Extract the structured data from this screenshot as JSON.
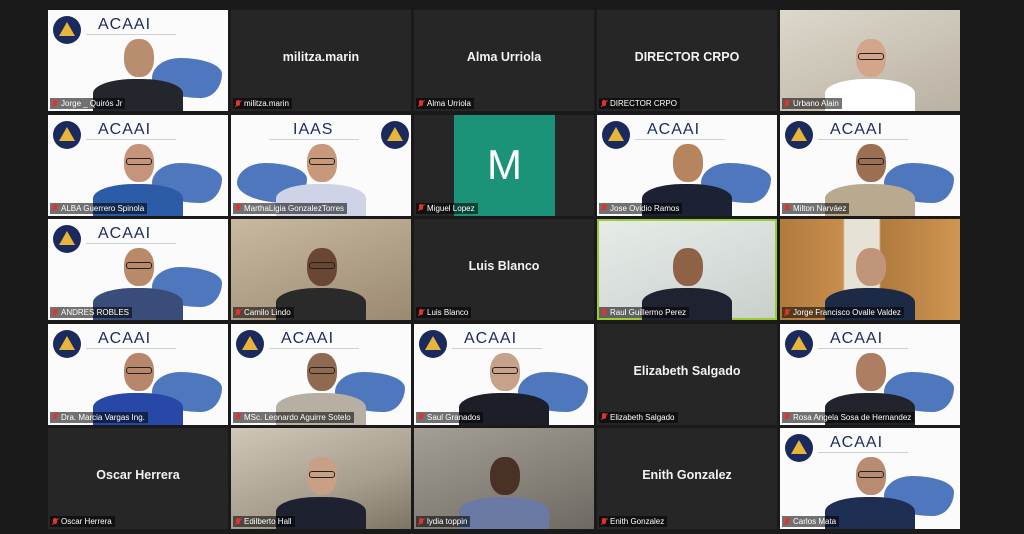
{
  "participants": [
    {
      "name": "Jorge _ Quirós Jr",
      "bg": "acaai",
      "video": true,
      "skin": "#b98e6f",
      "shirt": "#24262d",
      "glasses": false
    },
    {
      "name": "militza.marin",
      "bg": "none",
      "video": false
    },
    {
      "name": "Alma Urriola",
      "bg": "none",
      "video": false
    },
    {
      "name": "DIRECTOR CRPO",
      "bg": "none",
      "video": false
    },
    {
      "name": "Urbano Alain",
      "bg": "room2",
      "video": true,
      "skin": "#d3a58a",
      "shirt": "#ffffff",
      "glasses": true
    },
    {
      "name": "ALBA Guerrero Spinola",
      "bg": "acaai",
      "video": true,
      "skin": "#c4957a",
      "shirt": "#2c5ba8",
      "glasses": true
    },
    {
      "name": "MarthaLigia GonzalezTorres",
      "bg": "iaas",
      "video": true,
      "skin": "#c8987a",
      "shirt": "#cfd3e8",
      "glasses": true
    },
    {
      "name": "Miguel Lopez",
      "bg": "avatar",
      "video": false,
      "avatar": "M"
    },
    {
      "name": "Jose Ovidio Ramos",
      "bg": "acaai",
      "video": true,
      "skin": "#b6845f",
      "shirt": "#1c2233",
      "glasses": false
    },
    {
      "name": "Milton Narváez",
      "bg": "acaai",
      "video": true,
      "skin": "#9d6f52",
      "shirt": "#b8a98f",
      "glasses": true
    },
    {
      "name": "ANDRES ROBLES",
      "bg": "acaai",
      "video": true,
      "skin": "#b98a6a",
      "shirt": "#3a4c79",
      "glasses": true
    },
    {
      "name": "Camilo Lindo",
      "bg": "office",
      "video": true,
      "skin": "#6a4634",
      "shirt": "#2a2a2a",
      "glasses": true
    },
    {
      "name": "Luis Blanco",
      "bg": "none",
      "video": false
    },
    {
      "name": "Raul Guillermo Perez",
      "bg": "wall",
      "video": true,
      "skin": "#8f6248",
      "shirt": "#1f2230",
      "glasses": false,
      "active": true
    },
    {
      "name": "Jorge Francisco Ovalle Valdez",
      "bg": "kitchen",
      "video": true,
      "skin": "#c1957a",
      "shirt": "#1d2a46",
      "glasses": false
    },
    {
      "name": "Dra. Marcia Vargas Ing.",
      "bg": "acaai",
      "video": true,
      "skin": "#b8866a",
      "shirt": "#2848a8",
      "glasses": true
    },
    {
      "name": "MSc. Leonardo Aguirre Sotelo",
      "bg": "acaai",
      "video": true,
      "skin": "#8f6a50",
      "shirt": "#b7b0a2",
      "glasses": true
    },
    {
      "name": "Saul Granados",
      "bg": "acaai",
      "video": true,
      "skin": "#c7a189",
      "shirt": "#1c1f28",
      "glasses": true
    },
    {
      "name": "Elizabeth Salgado",
      "bg": "none",
      "video": false
    },
    {
      "name": "Rosa Angela Sosa de Hernandez",
      "bg": "acaai",
      "video": true,
      "skin": "#ad7e62",
      "shirt": "#21242c",
      "glasses": false
    },
    {
      "name": "Oscar Herrera",
      "bg": "none",
      "video": false
    },
    {
      "name": "Edilberto Hall",
      "bg": "room",
      "video": true,
      "skin": "#c99f85",
      "shirt": "#1e2230",
      "glasses": true
    },
    {
      "name": "lydia toppin",
      "bg": "home",
      "video": true,
      "skin": "#4a3126",
      "shirt": "#6b7aa4",
      "glasses": false
    },
    {
      "name": "Enith Gonzalez",
      "bg": "none",
      "video": false
    },
    {
      "name": "Carlos Mata",
      "bg": "acaai",
      "video": true,
      "skin": "#b88c70",
      "shirt": "#1e2d52",
      "glasses": true
    }
  ],
  "logo": {
    "acaai": "ACAAI",
    "iaas": "IAAS"
  },
  "colors": {
    "background": "#1a1a1a",
    "tile": "#262626",
    "active_border": "#9acd32",
    "mic_muted": "#e0332e",
    "avatar_bg": "#1a9378"
  }
}
